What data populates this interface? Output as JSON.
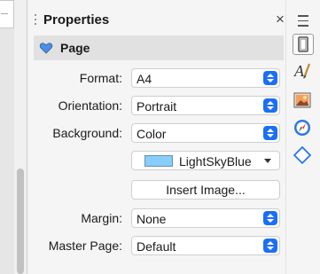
{
  "deck": {
    "title": "Properties",
    "close_glyph": "×",
    "menu_icon": "hamburger-menu-icon"
  },
  "panel": {
    "title": "Page",
    "icon": "heart-icon"
  },
  "form": {
    "format": {
      "label": "Format:",
      "value": "A4"
    },
    "orientation": {
      "label": "Orientation:",
      "value": "Portrait"
    },
    "background": {
      "label": "Background:",
      "value": "Color"
    },
    "background_color": {
      "name": "LightSkyBlue",
      "hex": "#87CEFA"
    },
    "insert_image_label": "Insert Image...",
    "margin": {
      "label": "Margin:",
      "value": "None"
    },
    "master_page": {
      "label": "Master Page:",
      "value": "Default"
    }
  },
  "tabs": [
    {
      "icon": "properties-page-icon",
      "active": true
    },
    {
      "icon": "styles-icon",
      "active": false
    },
    {
      "icon": "gallery-icon",
      "active": false
    },
    {
      "icon": "navigator-icon",
      "active": false
    },
    {
      "icon": "shapes-icon",
      "active": false
    }
  ],
  "colors": {
    "accent": "#1B6FF5",
    "header_bg": "#E1E1E1",
    "panel_bg": "#F5F5F5"
  }
}
